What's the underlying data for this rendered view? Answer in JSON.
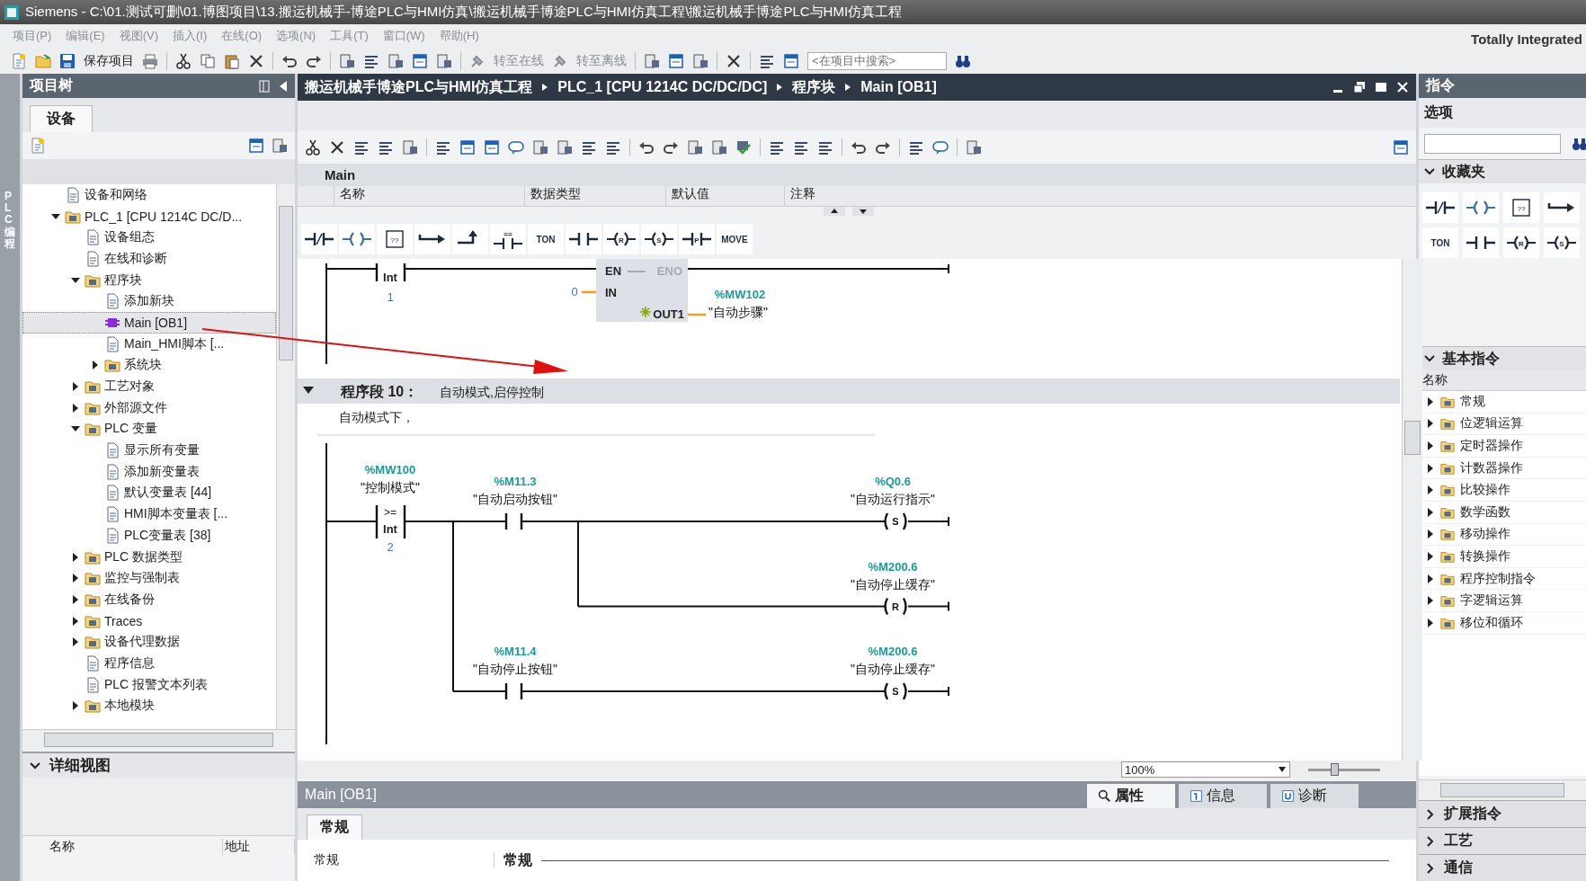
{
  "window": {
    "title": "Siemens  -  C:\\01.测试可删\\01.博图项目\\13.搬运机械手-博途PLC与HMI仿真\\搬运机械手博途PLC与HMI仿真工程\\搬运机械手博途PLC与HMI仿真工程"
  },
  "menu": [
    "项目(P)",
    "编辑(E)",
    "视图(V)",
    "插入(I)",
    "在线(O)",
    "选项(N)",
    "工具(T)",
    "窗口(W)",
    "帮助(H)"
  ],
  "brand": "Totally Integrated",
  "toolbar": {
    "buttons": [
      {
        "label": "保存项目",
        "disabled": false
      },
      {
        "label": "转至在线",
        "disabled": true
      },
      {
        "label": "转至离线",
        "disabled": true
      }
    ],
    "search_placeholder": "<在项目中搜索>"
  },
  "side_tab": "PLC 编程",
  "project_tree": {
    "title": "项目树",
    "tab": "设备",
    "items": [
      {
        "label": "设备和网络",
        "selected": false
      },
      {
        "label": "PLC_1 [CPU 1214C DC/D...",
        "selected": false,
        "expanded": true,
        "children": [
          {
            "label": "设备组态",
            "selected": false
          },
          {
            "label": "在线和诊断",
            "selected": false
          },
          {
            "label": "程序块",
            "selected": false,
            "expanded": true,
            "children": [
              {
                "label": "添加新块",
                "selected": false
              },
              {
                "label": "Main [OB1]",
                "selected": true
              },
              {
                "label": "Main_HMI脚本 [...",
                "selected": false
              },
              {
                "label": "系统块",
                "selected": false,
                "expanded": false
              }
            ]
          },
          {
            "label": "工艺对象",
            "selected": false,
            "expanded": false
          },
          {
            "label": "外部源文件",
            "selected": false,
            "expanded": false
          },
          {
            "label": "PLC 变量",
            "selected": false,
            "expanded": true,
            "children": [
              {
                "label": "显示所有变量",
                "selected": false
              },
              {
                "label": "添加新变量表",
                "selected": false
              },
              {
                "label": "默认变量表 [44]",
                "selected": false
              },
              {
                "label": "HMI脚本变量表 [...",
                "selected": false
              },
              {
                "label": "PLC变量表 [38]",
                "selected": false
              }
            ]
          },
          {
            "label": "PLC 数据类型",
            "selected": false,
            "expanded": false
          },
          {
            "label": "监控与强制表",
            "selected": false,
            "expanded": false
          },
          {
            "label": "在线备份",
            "selected": false,
            "expanded": false
          },
          {
            "label": "Traces",
            "selected": false,
            "expanded": false
          },
          {
            "label": "设备代理数据",
            "selected": false,
            "expanded": false
          },
          {
            "label": "程序信息",
            "selected": false
          },
          {
            "label": "PLC 报警文本列表",
            "selected": false
          },
          {
            "label": "本地模块",
            "selected": false,
            "expanded": false
          }
        ]
      }
    ]
  },
  "detail_view": {
    "title": "详细视图",
    "columns": [
      "名称",
      "地址"
    ]
  },
  "editor": {
    "breadcrumb": [
      "搬运机械手博途PLC与HMI仿真工程",
      "PLC_1 [CPU 1214C DC/DC/DC]",
      "程序块",
      "Main [OB1]"
    ],
    "block_name": "Main",
    "interface_columns": [
      "名称",
      "数据类型",
      "默认值",
      "注释"
    ],
    "favorites": [
      {
        "kind": "nc"
      },
      {
        "kind": "coil"
      },
      {
        "kind": "empty-box",
        "label": "??"
      },
      {
        "kind": "jump"
      },
      {
        "kind": "return"
      },
      {
        "kind": "compare",
        "label": "=="
      },
      {
        "kind": "text",
        "label": "TON"
      },
      {
        "kind": "no"
      },
      {
        "kind": "coil-letter",
        "label": "R"
      },
      {
        "kind": "coil-letter",
        "label": "S"
      },
      {
        "kind": "contact-letter",
        "label": "P"
      },
      {
        "kind": "text",
        "label": "MOVE"
      }
    ],
    "previous_network": {
      "compare": {
        "type": "Int",
        "value": "1"
      },
      "move": {
        "en": "EN",
        "eno": "ENO",
        "in": "IN",
        "out": "OUT1",
        "in_value": "0",
        "out_address": "%MW102",
        "out_symbol": "\"自动步骤\""
      }
    },
    "network": {
      "title": "程序段 10：",
      "name": "自动模式,启停控制",
      "expanded": true,
      "comment": "自动模式下，",
      "compare": {
        "address": "%MW100",
        "symbol": "\"控制模式\"",
        "op": ">=",
        "type": "Int",
        "value": "2"
      },
      "rungs": [
        {
          "contact": {
            "address": "%M11.3",
            "symbol": "\"自动启动按钮\""
          },
          "coils": [
            {
              "letter": "S",
              "address": "%Q0.6",
              "symbol": "\"自动运行指示\""
            },
            {
              "letter": "R",
              "address": "%M200.6",
              "symbol": "\"自动停止缓存\""
            }
          ]
        },
        {
          "contact": {
            "address": "%M11.4",
            "symbol": "\"自动停止按钮\""
          },
          "coils": [
            {
              "letter": "S",
              "address": "%M200.6",
              "symbol": "\"自动停止缓存\""
            }
          ]
        }
      ]
    },
    "zoom": {
      "value": "100%",
      "level": 0.35
    }
  },
  "inspector": {
    "title": "Main [OB1]",
    "tabs": [
      {
        "label": "属性",
        "selected": true
      },
      {
        "label": "信息",
        "selected": false
      },
      {
        "label": "诊断",
        "selected": false
      }
    ],
    "subtab": "常规",
    "nav": [
      "常规"
    ],
    "section": "常规"
  },
  "instructions": {
    "title": "指令",
    "options": "选项",
    "favorites_title": "收藏夹",
    "favorites": [
      {
        "kind": "nc"
      },
      {
        "kind": "coil"
      },
      {
        "kind": "empty-box",
        "label": "??"
      },
      {
        "kind": "jump"
      },
      {
        "kind": "text",
        "label": "TON"
      },
      {
        "kind": "no"
      },
      {
        "kind": "coil-letter",
        "label": "R"
      },
      {
        "kind": "coil-letter",
        "label": "S"
      }
    ],
    "basic_title": "基本指令",
    "column": "名称",
    "basic_items": [
      {
        "label": "常规",
        "expanded": false
      },
      {
        "label": "位逻辑运算",
        "expanded": false
      },
      {
        "label": "定时器操作",
        "expanded": false
      },
      {
        "label": "计数器操作",
        "expanded": false
      },
      {
        "label": "比较操作",
        "expanded": false
      },
      {
        "label": "数学函数",
        "expanded": false
      },
      {
        "label": "移动操作",
        "expanded": false
      },
      {
        "label": "转换操作",
        "expanded": false
      },
      {
        "label": "程序控制指令",
        "expanded": false
      },
      {
        "label": "字逻辑运算",
        "expanded": false
      },
      {
        "label": "移位和循环",
        "expanded": false
      }
    ],
    "sections": [
      "扩展指令",
      "工艺",
      "通信"
    ]
  }
}
